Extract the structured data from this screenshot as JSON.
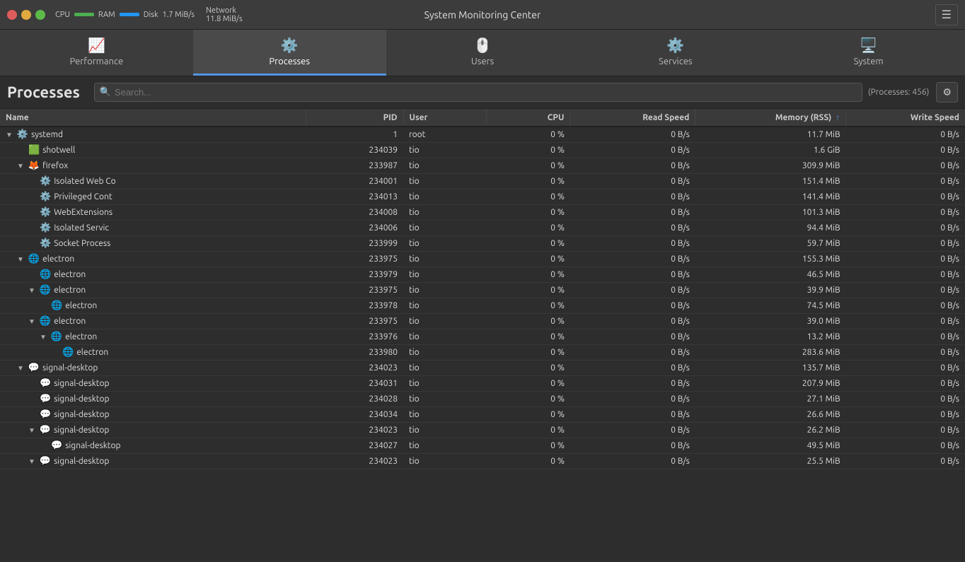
{
  "titlebar": {
    "title": "System Monitoring Center",
    "cpu_label": "CPU",
    "ram_label": "RAM",
    "disk_label": "Disk",
    "network_label": "Network",
    "disk_value": "1.7 MiB/s",
    "network_value": "11.8 MiB/s"
  },
  "tabs": [
    {
      "id": "performance",
      "label": "Performance",
      "icon": "📈",
      "active": false
    },
    {
      "id": "processes",
      "label": "Processes",
      "icon": "⚙️",
      "active": true
    },
    {
      "id": "users",
      "label": "Users",
      "icon": "🖱️",
      "active": false
    },
    {
      "id": "services",
      "label": "Services",
      "icon": "⚙️",
      "active": false
    },
    {
      "id": "system",
      "label": "System",
      "icon": "🖥️",
      "active": false
    }
  ],
  "search": {
    "placeholder": "Search...",
    "count": "(Processes: 456)"
  },
  "page_title": "Processes",
  "columns": [
    {
      "id": "name",
      "label": "Name"
    },
    {
      "id": "pid",
      "label": "PID"
    },
    {
      "id": "user",
      "label": "User"
    },
    {
      "id": "cpu",
      "label": "CPU"
    },
    {
      "id": "read_speed",
      "label": "Read Speed"
    },
    {
      "id": "memory",
      "label": "Memory (RSS) ↑"
    },
    {
      "id": "write_speed",
      "label": "Write Speed"
    }
  ],
  "processes": [
    {
      "indent": 0,
      "toggle": "▼",
      "icon": "⚙️",
      "name": "systemd",
      "pid": "1",
      "user": "root",
      "cpu": "0 %",
      "read": "0 B/s",
      "mem": "11.7 MiB",
      "write": "0 B/s"
    },
    {
      "indent": 1,
      "toggle": "",
      "icon": "🟩",
      "name": "shotwell",
      "pid": "234039",
      "user": "tio",
      "cpu": "0 %",
      "read": "0 B/s",
      "mem": "1.6 GiB",
      "write": "0 B/s"
    },
    {
      "indent": 1,
      "toggle": "▼",
      "icon": "🦊",
      "name": "firefox",
      "pid": "233987",
      "user": "tio",
      "cpu": "0 %",
      "read": "0 B/s",
      "mem": "309.9 MiB",
      "write": "0 B/s"
    },
    {
      "indent": 2,
      "toggle": "",
      "icon": "⚙️",
      "name": "Isolated Web Co",
      "pid": "234001",
      "user": "tio",
      "cpu": "0 %",
      "read": "0 B/s",
      "mem": "151.4 MiB",
      "write": "0 B/s"
    },
    {
      "indent": 2,
      "toggle": "",
      "icon": "⚙️",
      "name": "Privileged Cont",
      "pid": "234013",
      "user": "tio",
      "cpu": "0 %",
      "read": "0 B/s",
      "mem": "141.4 MiB",
      "write": "0 B/s"
    },
    {
      "indent": 2,
      "toggle": "",
      "icon": "⚙️",
      "name": "WebExtensions",
      "pid": "234008",
      "user": "tio",
      "cpu": "0 %",
      "read": "0 B/s",
      "mem": "101.3 MiB",
      "write": "0 B/s"
    },
    {
      "indent": 2,
      "toggle": "",
      "icon": "⚙️",
      "name": "Isolated Servic",
      "pid": "234006",
      "user": "tio",
      "cpu": "0 %",
      "read": "0 B/s",
      "mem": "94.4 MiB",
      "write": "0 B/s"
    },
    {
      "indent": 2,
      "toggle": "",
      "icon": "⚙️",
      "name": "Socket Process",
      "pid": "233999",
      "user": "tio",
      "cpu": "0 %",
      "read": "0 B/s",
      "mem": "59.7 MiB",
      "write": "0 B/s"
    },
    {
      "indent": 1,
      "toggle": "▼",
      "icon": "🌐",
      "name": "electron",
      "pid": "233975",
      "user": "tio",
      "cpu": "0 %",
      "read": "0 B/s",
      "mem": "155.3 MiB",
      "write": "0 B/s"
    },
    {
      "indent": 2,
      "toggle": "",
      "icon": "🌐",
      "name": "electron",
      "pid": "233979",
      "user": "tio",
      "cpu": "0 %",
      "read": "0 B/s",
      "mem": "46.5 MiB",
      "write": "0 B/s"
    },
    {
      "indent": 2,
      "toggle": "▼",
      "icon": "🌐",
      "name": "electron",
      "pid": "233975",
      "user": "tio",
      "cpu": "0 %",
      "read": "0 B/s",
      "mem": "39.9 MiB",
      "write": "0 B/s"
    },
    {
      "indent": 3,
      "toggle": "",
      "icon": "🌐",
      "name": "electron",
      "pid": "233978",
      "user": "tio",
      "cpu": "0 %",
      "read": "0 B/s",
      "mem": "74.5 MiB",
      "write": "0 B/s"
    },
    {
      "indent": 2,
      "toggle": "▼",
      "icon": "🌐",
      "name": "electron",
      "pid": "233975",
      "user": "tio",
      "cpu": "0 %",
      "read": "0 B/s",
      "mem": "39.0 MiB",
      "write": "0 B/s"
    },
    {
      "indent": 3,
      "toggle": "▼",
      "icon": "🌐",
      "name": "electron",
      "pid": "233976",
      "user": "tio",
      "cpu": "0 %",
      "read": "0 B/s",
      "mem": "13.2 MiB",
      "write": "0 B/s"
    },
    {
      "indent": 4,
      "toggle": "",
      "icon": "🌐",
      "name": "electron",
      "pid": "233980",
      "user": "tio",
      "cpu": "0 %",
      "read": "0 B/s",
      "mem": "283.6 MiB",
      "write": "0 B/s"
    },
    {
      "indent": 1,
      "toggle": "▼",
      "icon": "💬",
      "name": "signal-desktop",
      "pid": "234023",
      "user": "tio",
      "cpu": "0 %",
      "read": "0 B/s",
      "mem": "135.7 MiB",
      "write": "0 B/s"
    },
    {
      "indent": 2,
      "toggle": "",
      "icon": "💬",
      "name": "signal-desktop",
      "pid": "234031",
      "user": "tio",
      "cpu": "0 %",
      "read": "0 B/s",
      "mem": "207.9 MiB",
      "write": "0 B/s"
    },
    {
      "indent": 2,
      "toggle": "",
      "icon": "💬",
      "name": "signal-desktop",
      "pid": "234028",
      "user": "tio",
      "cpu": "0 %",
      "read": "0 B/s",
      "mem": "27.1 MiB",
      "write": "0 B/s"
    },
    {
      "indent": 2,
      "toggle": "",
      "icon": "💬",
      "name": "signal-desktop",
      "pid": "234034",
      "user": "tio",
      "cpu": "0 %",
      "read": "0 B/s",
      "mem": "26.6 MiB",
      "write": "0 B/s"
    },
    {
      "indent": 2,
      "toggle": "▼",
      "icon": "💬",
      "name": "signal-desktop",
      "pid": "234023",
      "user": "tio",
      "cpu": "0 %",
      "read": "0 B/s",
      "mem": "26.2 MiB",
      "write": "0 B/s"
    },
    {
      "indent": 3,
      "toggle": "",
      "icon": "💬",
      "name": "signal-desktop",
      "pid": "234027",
      "user": "tio",
      "cpu": "0 %",
      "read": "0 B/s",
      "mem": "49.5 MiB",
      "write": "0 B/s"
    },
    {
      "indent": 2,
      "toggle": "▼",
      "icon": "💬",
      "name": "signal-desktop",
      "pid": "234023",
      "user": "tio",
      "cpu": "0 %",
      "read": "0 B/s",
      "mem": "25.5 MiB",
      "write": "0 B/s"
    }
  ]
}
